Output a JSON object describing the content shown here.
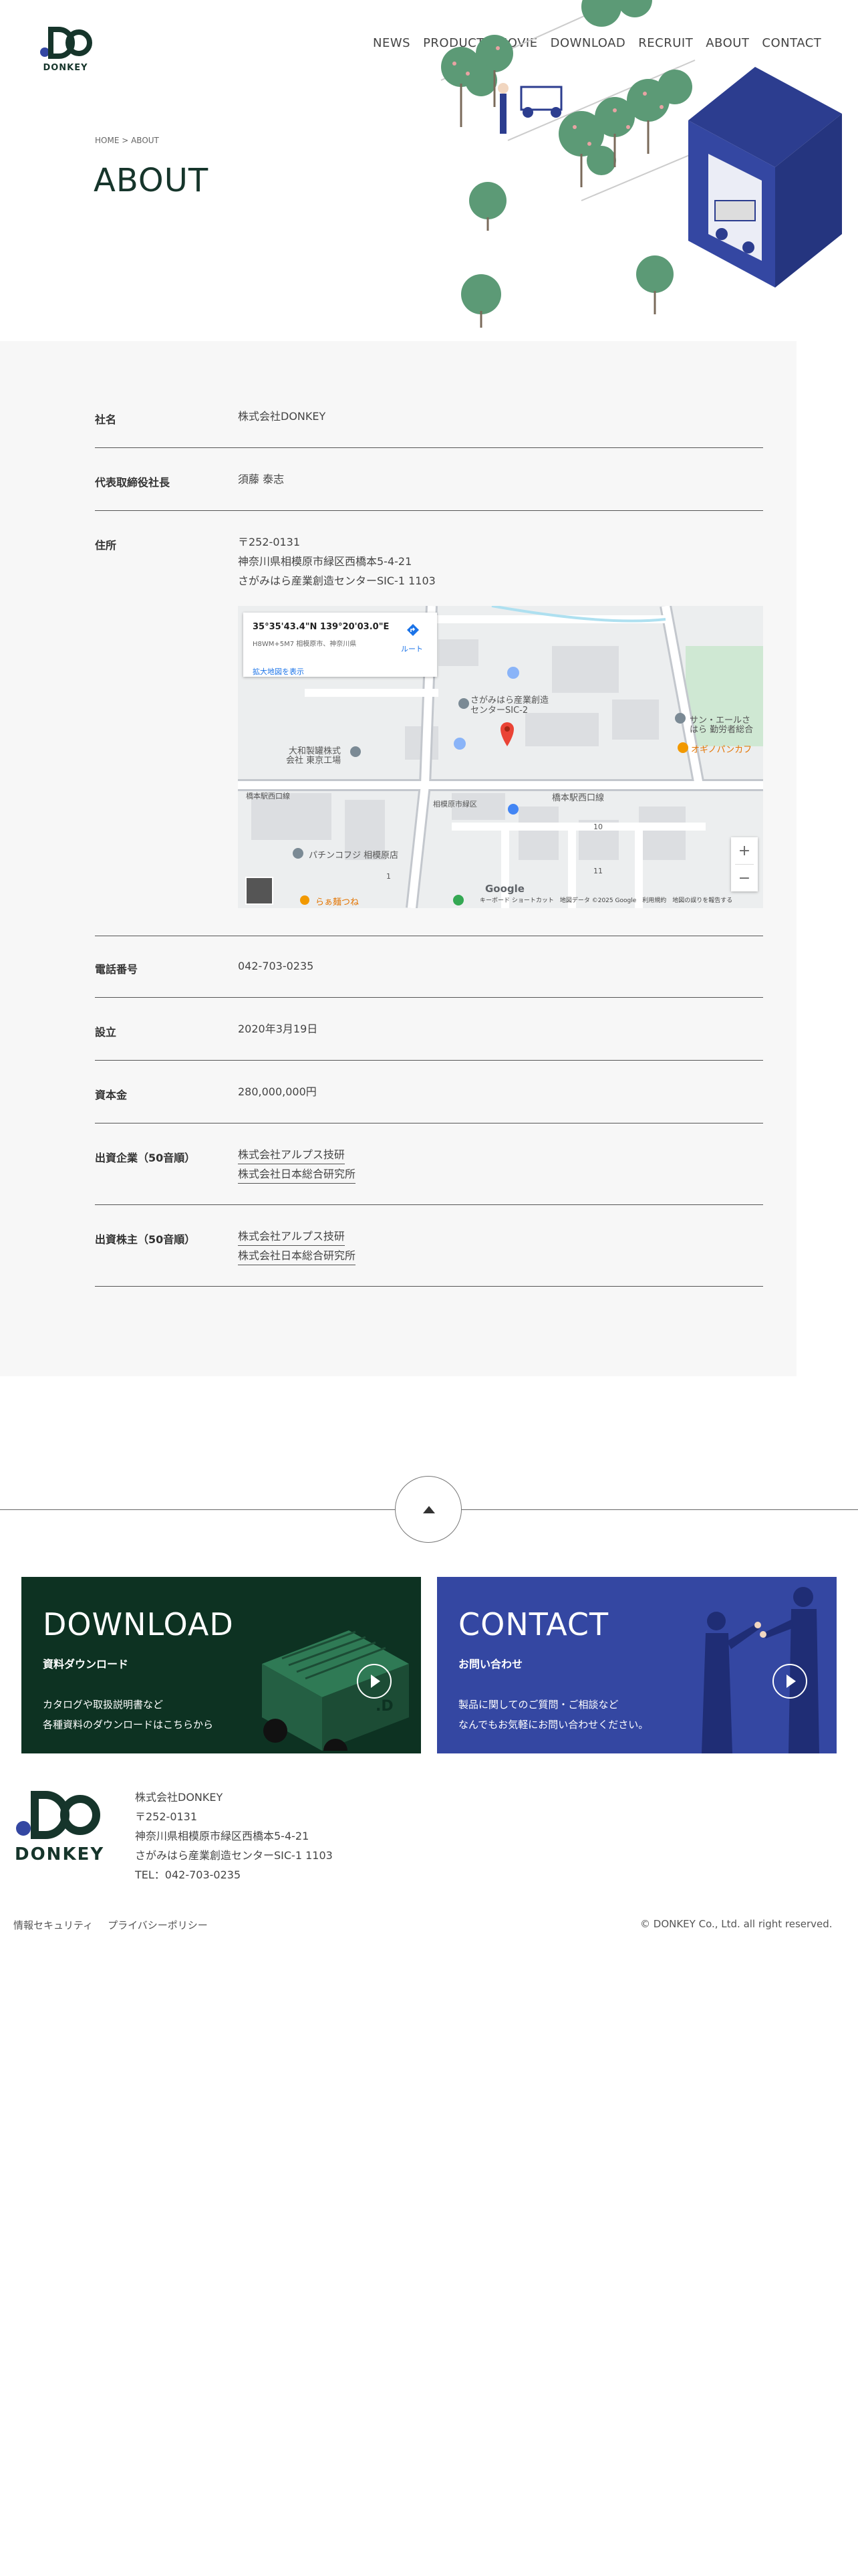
{
  "header": {
    "logo_text": "DONKEY",
    "nav": [
      "NEWS",
      "PRODUCT",
      "MOVIE",
      "DOWNLOAD",
      "RECRUIT",
      "ABOUT",
      "CONTACT"
    ]
  },
  "breadcrumb": "HOME > ABOUT",
  "page_title": "ABOUT",
  "company": {
    "name_label": "社名",
    "name": "株式会社DONKEY",
    "ceo_label": "代表取締役社長",
    "ceo": "須藤 泰志",
    "address_label": "住所",
    "zip": "〒252-0131",
    "address1": "神奈川県相模原市緑区西橋本5-4-21",
    "address2": "さがみはら産業創造センターSIC-1 1103",
    "tel_label": "電話番号",
    "tel": "042-703-0235",
    "founded_label": "設立",
    "founded": "2020年3月19日",
    "capital_label": "資本金",
    "capital": "280,000,000円",
    "investors_label": "出資企業（50音順）",
    "investors": [
      "株式会社アルプス技研",
      "株式会社日本総合研究所"
    ],
    "shareholders_label": "出資株主（50音順）",
    "shareholders": [
      "株式会社アルプス技研",
      "株式会社日本総合研究所"
    ]
  },
  "map": {
    "coord": "35°35'43.4\"N 139°20'03.0\"E",
    "addr": "H8WM+5M7 相模原市、神奈川県",
    "route": "ルート",
    "larger_map": "拡大地図を表示",
    "footer": "キーボード ショートカット　地図データ ©2025 Google　利用規約　地図の誤りを報告する",
    "google": "Google",
    "labels": {
      "l1": "さがみはら産業創造",
      "l2": "センターSIC-2",
      "l3": "大和製罐株式",
      "l4": "会社 東京工場",
      "l5": "橋本駅西口線",
      "l6": "パチンコフジ 相模原店",
      "l7": "らぁ麺つね",
      "l8": "サン・エールさ",
      "l9": "はら 勤労者総合",
      "l10": "オギノパンカフ",
      "l11": "相模原市緑区",
      "l12": "10",
      "l13": "11",
      "l14": "1",
      "l15": "橋本駅西口線"
    }
  },
  "pagetop_label": "ページトップ",
  "banners": {
    "download": {
      "title": "DOWNLOAD",
      "sub": "資料ダウンロード",
      "desc1": "カタログや取扱説明書など",
      "desc2": "各種資料のダウンロードはこちらから"
    },
    "contact": {
      "title": "CONTACT",
      "sub": "お問い合わせ",
      "desc1": "製品に関してのご質問・ご相談など",
      "desc2": "なんでもお気軽にお問い合わせください。"
    }
  },
  "footer": {
    "logo_text": "DONKEY",
    "company": "株式会社DONKEY",
    "zip": "〒252-0131",
    "address1": "神奈川県相模原市緑区西橋本5-4-21",
    "address2": "さがみはら産業創造センターSIC-1 1103",
    "tel": "TEL：042-703-0235",
    "links": [
      "情報セキュリティ",
      "プライバシーポリシー"
    ],
    "copyright": "© DONKEY Co., Ltd. all right reserved."
  },
  "colors": {
    "brand_green": "#0d3222",
    "brand_blue": "#3447a2",
    "tree_green": "#5c9a76"
  }
}
